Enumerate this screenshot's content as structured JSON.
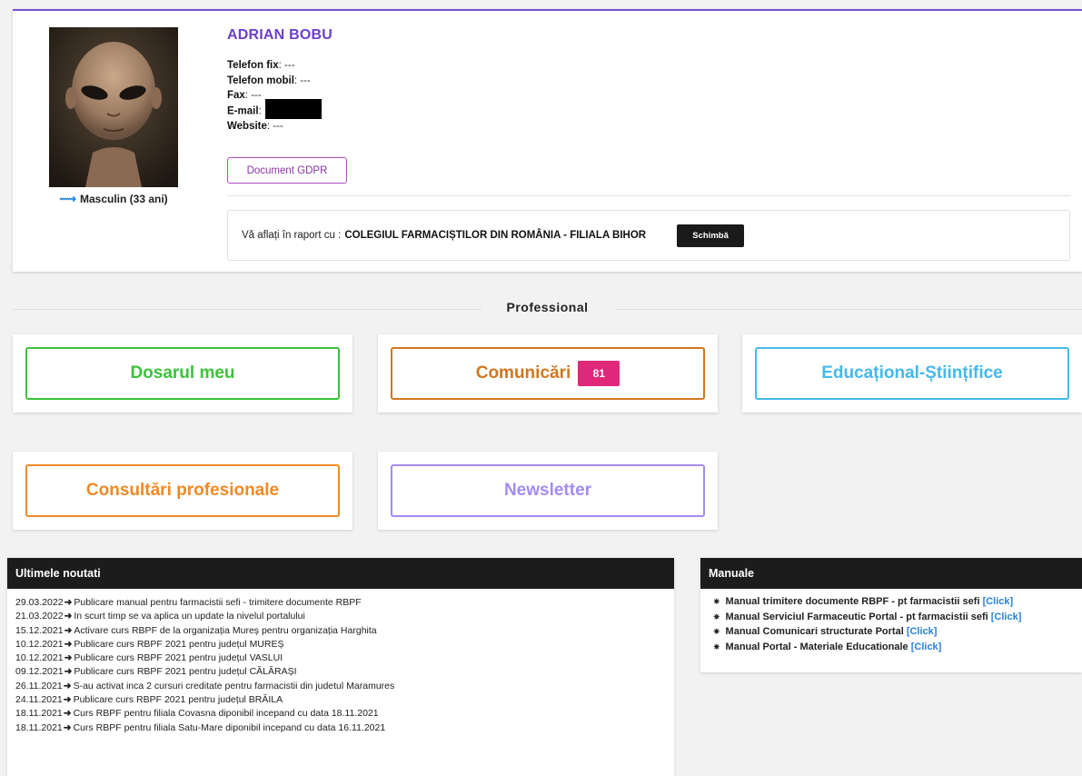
{
  "profile": {
    "name": "ADRIAN BOBU",
    "gender_age": "Masculin (33 ani)",
    "contacts": [
      {
        "label": "Telefon fix",
        "value": ": ---"
      },
      {
        "label": "Telefon mobil",
        "value": ": ---"
      },
      {
        "label": "Fax",
        "value": ": ---"
      },
      {
        "label": "E-mail",
        "value": ":"
      },
      {
        "label": "Website",
        "value": ": ---"
      }
    ],
    "gdpr_button": "Document GDPR",
    "relation_prefix": "Vă aflați în raport cu :",
    "relation_org": "COLEGIUL FARMACIȘTILOR DIN ROMÂNIA - FILIALA BIHOR",
    "change_button": "Schimbă"
  },
  "section": {
    "title": "Professional"
  },
  "tiles": {
    "dosar": {
      "label": "Dosarul meu",
      "color": "#3cc23c"
    },
    "comunicari": {
      "label": "Comunicări",
      "badge": "81",
      "color": "#d0771f",
      "badge_color": "#e0287a"
    },
    "educational": {
      "label": "Educațional-Științifice",
      "color": "#45b9ea"
    },
    "consultari": {
      "label": "Consultări profesionale",
      "color": "#f08a25"
    },
    "newsletter": {
      "label": "Newsletter",
      "color": "#a48cf0"
    }
  },
  "news": {
    "title": "Ultimele noutati",
    "items": [
      {
        "date": "29.03.2022",
        "text": "Publicare manual pentru farmacistii sefi - trimitere documente RBPF"
      },
      {
        "date": "21.03.2022",
        "text": "In scurt timp se va aplica un update la nivelul portalului"
      },
      {
        "date": "15.12.2021",
        "text": "Activare curs RBPF de la organizația Mureș pentru organizația Harghita"
      },
      {
        "date": "10.12.2021",
        "text": "Publicare curs RBPF 2021 pentru județul MUREȘ"
      },
      {
        "date": "10.12.2021",
        "text": "Publicare curs RBPF 2021 pentru județul VASLUI"
      },
      {
        "date": "09.12.2021",
        "text": "Publicare curs RBPF 2021 pentru județul CĂLĂRAȘI"
      },
      {
        "date": "26.11.2021",
        "text": "S-au activat inca 2 cursuri creditate pentru farmacistii din judetul Maramures"
      },
      {
        "date": "24.11.2021",
        "text": "Publicare curs RBPF 2021 pentru județul BRĂILA"
      },
      {
        "date": "18.11.2021",
        "text": "Curs RBPF pentru filiala Covasna diponibil incepand cu data 18.11.2021"
      },
      {
        "date": "18.11.2021",
        "text": "Curs RBPF pentru filiala Satu-Mare diponibil incepand cu data 16.11.2021"
      }
    ]
  },
  "manuals": {
    "title": "Manuale",
    "click_label": "[Click]",
    "items": [
      {
        "text": "Manual trimitere documente RBPF - pt farmacistii sefi"
      },
      {
        "text": "Manual Serviciul Farmaceutic Portal - pt farmacistii sefi"
      },
      {
        "text": "Manual Comunicari structurate Portal"
      },
      {
        "text": "Manual Portal - Materiale Educationale"
      }
    ]
  },
  "colors": {
    "accent": "#6b3fc9",
    "header_dark": "#1c1c1c",
    "link": "#2a7fd4"
  }
}
